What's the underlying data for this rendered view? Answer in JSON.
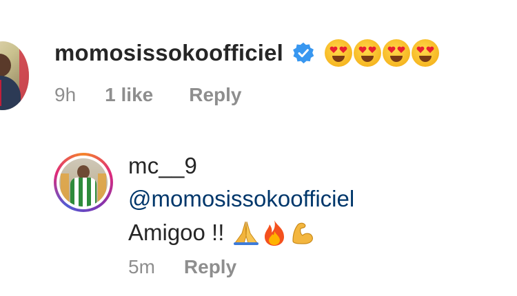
{
  "comment1": {
    "username": "momosissokoofficiel",
    "verified": true,
    "text_emojis": [
      "heart-eyes-emoji",
      "heart-eyes-emoji",
      "heart-eyes-emoji",
      "heart-eyes-emoji"
    ],
    "time": "9h",
    "likes": "1 like",
    "reply_label": "Reply"
  },
  "comment2": {
    "username": "mc__9",
    "mention": "@momosissokoofficiel",
    "text": "Amigoo !!",
    "text_emojis": [
      "folded-hands-emoji",
      "fire-emoji",
      "flexed-biceps-emoji"
    ],
    "time": "5m",
    "reply_label": "Reply"
  },
  "colors": {
    "username": "#262626",
    "meta": "#8e8e8e",
    "mention": "#00376b",
    "verified": "#3897f0"
  }
}
